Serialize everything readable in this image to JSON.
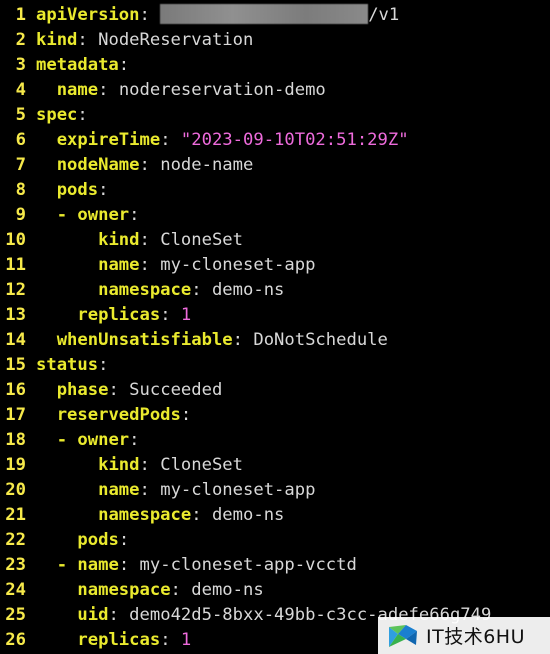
{
  "colors": {
    "background": "#000000",
    "line_number": "#f6e94a",
    "key": "#eaea2e",
    "plain_value": "#d8d8d8",
    "string_value": "#ee6bdc",
    "number_value": "#ee6bdc"
  },
  "redaction": {
    "icon": "blurred-redaction-block"
  },
  "watermark": {
    "text": "IT技术6HU",
    "icon": "site-logo-icon"
  },
  "lines": [
    {
      "n": "1",
      "indent": "",
      "dash": "",
      "key": "apiVersion",
      "sep": ":",
      "value": "",
      "vtype": "plain",
      "redacted": true,
      "suffix": "/v1"
    },
    {
      "n": "2",
      "indent": "",
      "dash": "",
      "key": "kind",
      "sep": ":",
      "value": "NodeReservation",
      "vtype": "plain"
    },
    {
      "n": "3",
      "indent": "",
      "dash": "",
      "key": "metadata",
      "sep": ":",
      "value": "",
      "vtype": "plain"
    },
    {
      "n": "4",
      "indent": "  ",
      "dash": "",
      "key": "name",
      "sep": ":",
      "value": "nodereservation-demo",
      "vtype": "plain"
    },
    {
      "n": "5",
      "indent": "",
      "dash": "",
      "key": "spec",
      "sep": ":",
      "value": "",
      "vtype": "plain"
    },
    {
      "n": "6",
      "indent": "  ",
      "dash": "",
      "key": "expireTime",
      "sep": ":",
      "value": "\"2023-09-10T02:51:29Z\"",
      "vtype": "str"
    },
    {
      "n": "7",
      "indent": "  ",
      "dash": "",
      "key": "nodeName",
      "sep": ":",
      "value": "node-name",
      "vtype": "plain"
    },
    {
      "n": "8",
      "indent": "  ",
      "dash": "",
      "key": "pods",
      "sep": ":",
      "value": "",
      "vtype": "plain"
    },
    {
      "n": "9",
      "indent": "  ",
      "dash": "- ",
      "key": "owner",
      "sep": ":",
      "value": "",
      "vtype": "plain"
    },
    {
      "n": "10",
      "indent": "      ",
      "dash": "",
      "key": "kind",
      "sep": ":",
      "value": "CloneSet",
      "vtype": "plain"
    },
    {
      "n": "11",
      "indent": "      ",
      "dash": "",
      "key": "name",
      "sep": ":",
      "value": "my-cloneset-app",
      "vtype": "plain"
    },
    {
      "n": "12",
      "indent": "      ",
      "dash": "",
      "key": "namespace",
      "sep": ":",
      "value": "demo-ns",
      "vtype": "plain"
    },
    {
      "n": "13",
      "indent": "    ",
      "dash": "",
      "key": "replicas",
      "sep": ":",
      "value": "1",
      "vtype": "num"
    },
    {
      "n": "14",
      "indent": "  ",
      "dash": "",
      "key": "whenUnsatisfiable",
      "sep": ":",
      "value": "DoNotSchedule",
      "vtype": "plain"
    },
    {
      "n": "15",
      "indent": "",
      "dash": "",
      "key": "status",
      "sep": ":",
      "value": "",
      "vtype": "plain"
    },
    {
      "n": "16",
      "indent": "  ",
      "dash": "",
      "key": "phase",
      "sep": ":",
      "value": "Succeeded",
      "vtype": "plain"
    },
    {
      "n": "17",
      "indent": "  ",
      "dash": "",
      "key": "reservedPods",
      "sep": ":",
      "value": "",
      "vtype": "plain"
    },
    {
      "n": "18",
      "indent": "  ",
      "dash": "- ",
      "key": "owner",
      "sep": ":",
      "value": "",
      "vtype": "plain"
    },
    {
      "n": "19",
      "indent": "      ",
      "dash": "",
      "key": "kind",
      "sep": ":",
      "value": "CloneSet",
      "vtype": "plain"
    },
    {
      "n": "20",
      "indent": "      ",
      "dash": "",
      "key": "name",
      "sep": ":",
      "value": "my-cloneset-app",
      "vtype": "plain"
    },
    {
      "n": "21",
      "indent": "      ",
      "dash": "",
      "key": "namespace",
      "sep": ":",
      "value": "demo-ns",
      "vtype": "plain"
    },
    {
      "n": "22",
      "indent": "    ",
      "dash": "",
      "key": "pods",
      "sep": ":",
      "value": "",
      "vtype": "plain"
    },
    {
      "n": "23",
      "indent": "  ",
      "dash": "- ",
      "key": "name",
      "sep": ":",
      "value": "my-cloneset-app-vcctd",
      "vtype": "plain"
    },
    {
      "n": "24",
      "indent": "    ",
      "dash": "",
      "key": "namespace",
      "sep": ":",
      "value": "demo-ns",
      "vtype": "plain"
    },
    {
      "n": "25",
      "indent": "    ",
      "dash": "",
      "key": "uid",
      "sep": ":",
      "value": "demo42d5-8bxx-49bb-c3cc-adefe66g749",
      "vtype": "plain"
    },
    {
      "n": "26",
      "indent": "    ",
      "dash": "",
      "key": "replicas",
      "sep": ":",
      "value": "1",
      "vtype": "num"
    }
  ]
}
